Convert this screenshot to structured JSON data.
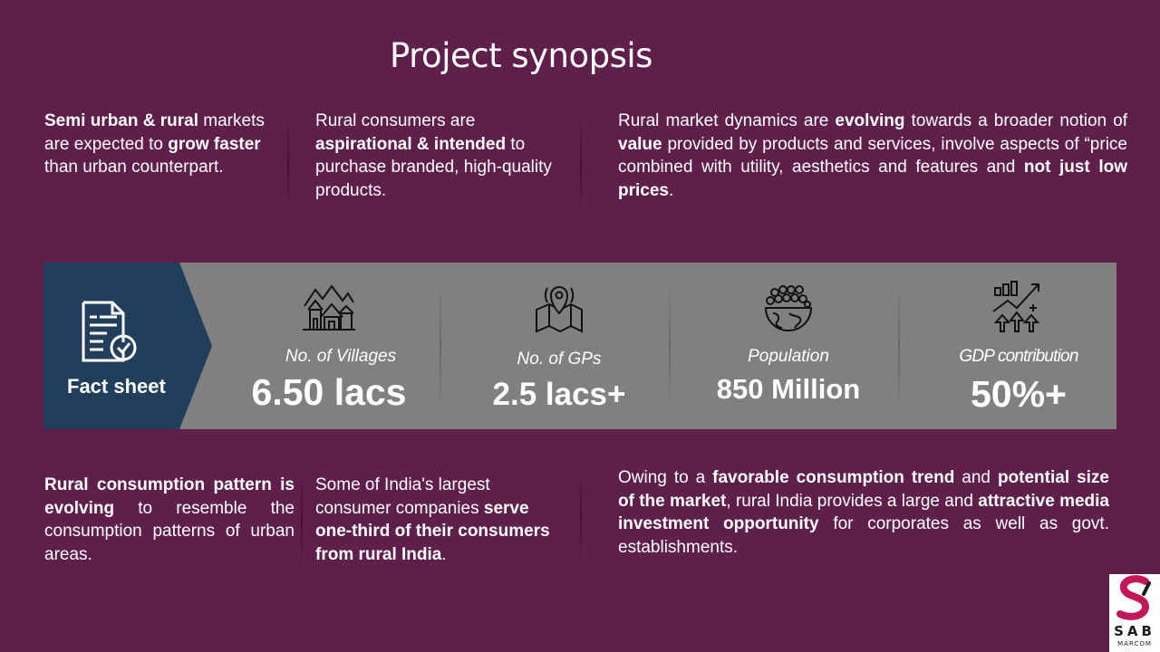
{
  "title": "Project synopsis",
  "top_blocks": [
    {
      "parts": [
        {
          "t": "Semi urban & rural",
          "b": true
        },
        {
          "t": " markets are expected to ",
          "b": false
        },
        {
          "t": "grow faster",
          "b": true
        },
        {
          "t": " than urban counterpart.",
          "b": false
        }
      ]
    },
    {
      "parts": [
        {
          "t": "Rural consumers are ",
          "b": false
        },
        {
          "t": "aspirational & intended",
          "b": true
        },
        {
          "t": " to purchase branded, high-quality products.",
          "b": false
        }
      ]
    },
    {
      "parts": [
        {
          "t": "Rural market dynamics are ",
          "b": false
        },
        {
          "t": "evolving",
          "b": true
        },
        {
          "t": " towards a broader notion of ",
          "b": false
        },
        {
          "t": "value",
          "b": true
        },
        {
          "t": " provided by products and services, involve aspects of “price combined with utility, aesthetics and features and ",
          "b": false
        },
        {
          "t": "not just low  prices",
          "b": true
        },
        {
          "t": ".",
          "b": false
        }
      ]
    }
  ],
  "fact_sheet": {
    "label": "Fact sheet",
    "icon": "checklist-document-icon",
    "stats": [
      {
        "label": "No. of Villages",
        "value": "6.50 lacs",
        "icon": "village-houses-icon"
      },
      {
        "label": "No. of GPs",
        "value": "2.5 lacs+",
        "icon": "map-pin-icon"
      },
      {
        "label": "Population",
        "value": "850 Million",
        "icon": "population-globe-icon"
      },
      {
        "label": "GDP contribution",
        "value": "50%+",
        "icon": "growth-chart-icon"
      }
    ]
  },
  "bottom_blocks": [
    {
      "parts": [
        {
          "t": "Rural consumption pattern is evolving",
          "b": true
        },
        {
          "t": " to resemble the consumption patterns of urban areas.",
          "b": false
        }
      ]
    },
    {
      "parts": [
        {
          "t": "Some of India's largest consumer companies ",
          "b": false
        },
        {
          "t": "serve one-third of their consumers from rural India",
          "b": true
        },
        {
          "t": ".",
          "b": false
        }
      ]
    },
    {
      "parts": [
        {
          "t": "Owing to a ",
          "b": false
        },
        {
          "t": "favorable consumption trend",
          "b": true
        },
        {
          "t": " and ",
          "b": false
        },
        {
          "t": "potential size of the market",
          "b": true
        },
        {
          "t": ", rural India provides a large and ",
          "b": false
        },
        {
          "t": "attractive media  investment opportunity",
          "b": true
        },
        {
          "t": " for corporates as well as govt. establishments.",
          "b": false
        }
      ]
    }
  ],
  "logo": {
    "text": "SAB",
    "sub": "MARCOM",
    "accent": "#c2185b"
  }
}
